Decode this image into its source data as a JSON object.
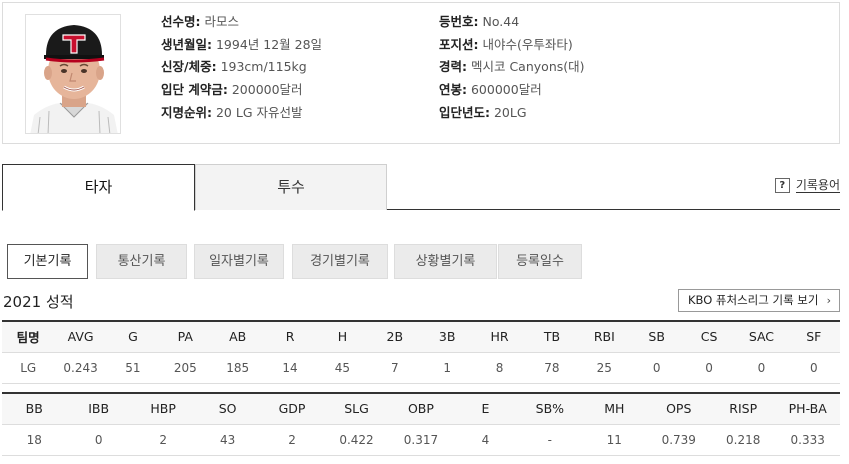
{
  "player": {
    "name_label": "선수명:",
    "name": "라모스",
    "birth_label": "생년월일:",
    "birth": "1994년 12월 28일",
    "body_label": "신장/체중:",
    "body": "193cm/115kg",
    "bonus_label": "입단 계약금:",
    "bonus": "200000달러",
    "draft_label": "지명순위:",
    "draft": "20 LG 자유선발",
    "number_label": "등번호:",
    "number": "No.44",
    "position_label": "포지션:",
    "position": "내야수(우투좌타)",
    "career_label": "경력:",
    "career": "멕시코 Canyons(대)",
    "salary_label": "연봉:",
    "salary": "600000달러",
    "join_label": "입단년도:",
    "join": "20LG"
  },
  "main_tabs": {
    "batter": "타자",
    "pitcher": "투수"
  },
  "glossary": {
    "icon": "?",
    "label": "기록용어"
  },
  "sub_tabs": [
    "기본기록",
    "통산기록",
    "일자별기록",
    "경기별기록",
    "상황별기록",
    "등록일수"
  ],
  "season_title": "2021 성적",
  "futures_button": "KBO 퓨처스리그 기록 보기",
  "futures_chevron": "›",
  "table1": {
    "headers": [
      "팀명",
      "AVG",
      "G",
      "PA",
      "AB",
      "R",
      "H",
      "2B",
      "3B",
      "HR",
      "TB",
      "RBI",
      "SB",
      "CS",
      "SAC",
      "SF"
    ],
    "row": [
      "LG",
      "0.243",
      "51",
      "205",
      "185",
      "14",
      "45",
      "7",
      "1",
      "8",
      "78",
      "25",
      "0",
      "0",
      "0",
      "0"
    ]
  },
  "table2": {
    "headers": [
      "BB",
      "IBB",
      "HBP",
      "SO",
      "GDP",
      "SLG",
      "OBP",
      "E",
      "SB%",
      "MH",
      "OPS",
      "RISP",
      "PH-BA"
    ],
    "row": [
      "18",
      "0",
      "2",
      "43",
      "2",
      "0.422",
      "0.317",
      "4",
      "-",
      "11",
      "0.739",
      "0.218",
      "0.333"
    ]
  }
}
